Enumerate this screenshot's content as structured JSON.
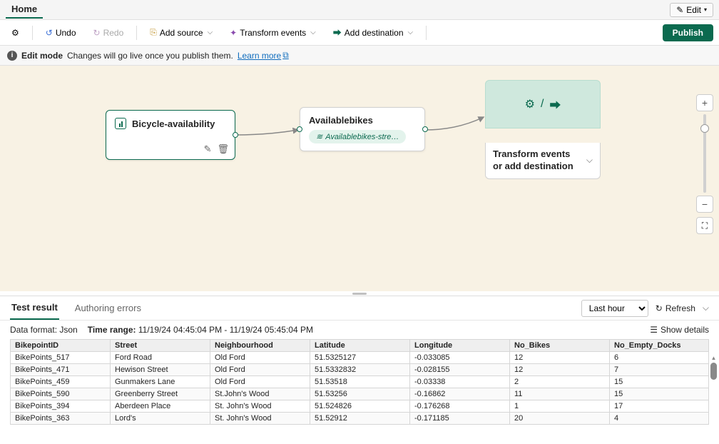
{
  "top": {
    "home": "Home",
    "edit": "Edit"
  },
  "toolbar": {
    "undo": "Undo",
    "redo": "Redo",
    "add_source": "Add source",
    "transform": "Transform events",
    "add_destination": "Add destination",
    "publish": "Publish"
  },
  "infobar": {
    "mode": "Edit mode",
    "msg": "Changes will go live once you publish them.",
    "learn_more": "Learn more"
  },
  "canvas": {
    "source": {
      "title": "Bicycle-availability"
    },
    "middle": {
      "title": "Availablebikes",
      "pill": "Availablebikes-stre…"
    },
    "dest": {
      "label": "Transform events or add destination"
    }
  },
  "results": {
    "tab1": "Test result",
    "tab2": "Authoring errors",
    "time_filter": "Last hour",
    "refresh": "Refresh",
    "data_format_label": "Data format:",
    "data_format_value": "Json",
    "time_range_label": "Time range:",
    "time_range_value": "11/19/24 04:45:04 PM - 11/19/24 05:45:04 PM",
    "show_details": "Show details",
    "columns": [
      "BikepointID",
      "Street",
      "Neighbourhood",
      "Latitude",
      "Longitude",
      "No_Bikes",
      "No_Empty_Docks"
    ],
    "rows": [
      [
        "BikePoints_517",
        "Ford Road",
        "Old Ford",
        "51.5325127",
        "-0.033085",
        "12",
        "6"
      ],
      [
        "BikePoints_471",
        "Hewison Street",
        "Old Ford",
        "51.5332832",
        "-0.028155",
        "12",
        "7"
      ],
      [
        "BikePoints_459",
        "Gunmakers Lane",
        "Old Ford",
        "51.53518",
        "-0.03338",
        "2",
        "15"
      ],
      [
        "BikePoints_590",
        "Greenberry Street",
        "St.John's Wood",
        "51.53256",
        "-0.16862",
        "11",
        "15"
      ],
      [
        "BikePoints_394",
        "Aberdeen Place",
        "St. John's Wood",
        "51.524826",
        "-0.176268",
        "1",
        "17"
      ],
      [
        "BikePoints_363",
        "Lord's",
        "St. John's Wood",
        "51.52912",
        "-0.171185",
        "20",
        "4"
      ]
    ]
  }
}
